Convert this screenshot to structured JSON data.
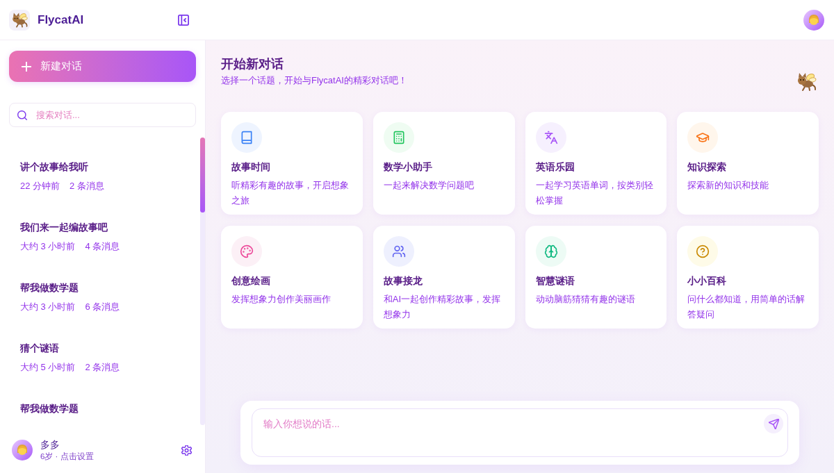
{
  "header": {
    "app_name": "FlycatAI"
  },
  "sidebar": {
    "new_chat_button": "新建对话",
    "search": {
      "placeholder": "搜索对话..."
    },
    "conversations": [
      {
        "title": "讲个故事给我听",
        "time": "22 分钟前",
        "messages": "2 条消息",
        "selected": false
      },
      {
        "title": "我们来一起编故事吧",
        "time": "大约 3 小时前",
        "messages": "4 条消息",
        "selected": false
      },
      {
        "title": "帮我做数学题",
        "time": "大约 3 小时前",
        "messages": "6 条消息",
        "selected": false
      },
      {
        "title": "猜个谜语",
        "time": "大约 5 小时前",
        "messages": "2 条消息",
        "selected": false
      },
      {
        "title": "帮我做数学题",
        "selected": false
      }
    ],
    "user": {
      "name": "多多",
      "detail": "6岁 · 点击设置"
    }
  },
  "main": {
    "title": "开始新对话",
    "subtitle": "选择一个话题，开始与FlycatAI的精彩对话吧！",
    "topics": [
      {
        "kind": "book",
        "title": "故事时间",
        "description": "听精彩有趣的故事，开启想象之旅"
      },
      {
        "kind": "calculator",
        "title": "数学小助手",
        "description": "一起来解决数学问题吧"
      },
      {
        "kind": "translate",
        "title": "英语乐园",
        "description": "一起学习英语单词，按类别轻松掌握"
      },
      {
        "kind": "graduation",
        "title": "知识探索",
        "description": "探索新的知识和技能"
      },
      {
        "kind": "palette",
        "title": "创意绘画",
        "description": "发挥想象力创作美丽画作"
      },
      {
        "kind": "people",
        "title": "故事接龙",
        "description": "和AI一起创作精彩故事，发挥想象力"
      },
      {
        "kind": "brain",
        "title": "智慧谜语",
        "description": "动动脑筋猜猜有趣的谜语"
      },
      {
        "kind": "question",
        "title": "小小百科",
        "description": "问什么都知道，用简单的话解答疑问"
      }
    ],
    "composer": {
      "placeholder": "输入你想说的话..."
    }
  }
}
